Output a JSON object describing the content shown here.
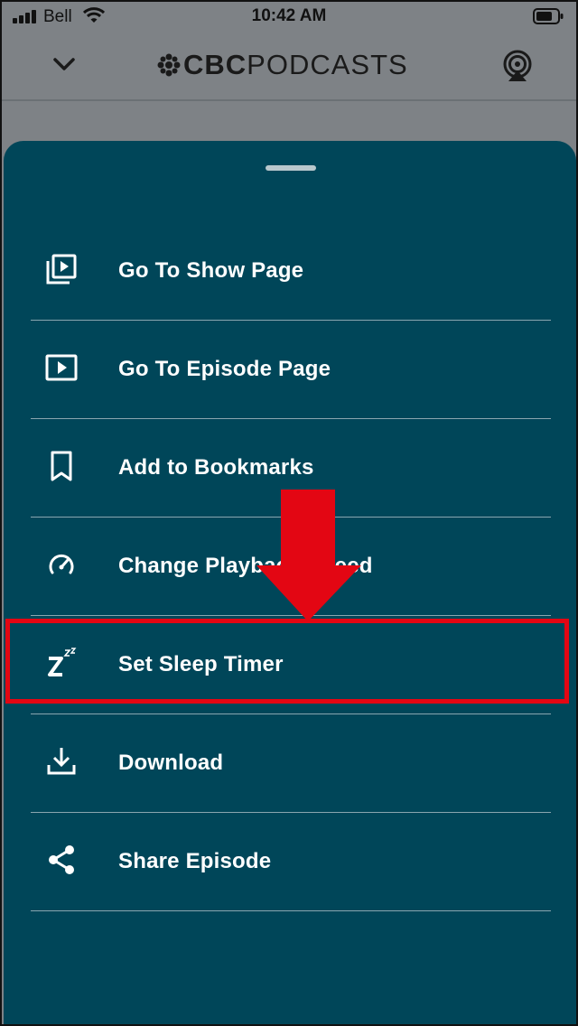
{
  "status_bar": {
    "carrier": "Bell",
    "time": "10:42 AM"
  },
  "header": {
    "logo_brand": "CBC",
    "logo_product": "PODCASTS",
    "icons": [
      "chevron-down-icon",
      "cbc-gem-icon",
      "airplay-icon"
    ]
  },
  "menu": {
    "items": [
      {
        "label": "Go To Show Page",
        "icon": "show-page-icon"
      },
      {
        "label": "Go To Episode Page",
        "icon": "play-icon"
      },
      {
        "label": "Add to Bookmarks",
        "icon": "bookmark-icon"
      },
      {
        "label": "Change Playback Speed",
        "icon": "speedometer-icon"
      },
      {
        "label": "Set Sleep Timer",
        "icon": "sleep-icon"
      },
      {
        "label": "Download",
        "icon": "download-icon"
      },
      {
        "label": "Share Episode",
        "icon": "share-icon"
      }
    ]
  },
  "colors": {
    "sheet_background": "#004659",
    "annotation_red": "#e30613",
    "dimmed_background": "#7e8286"
  }
}
